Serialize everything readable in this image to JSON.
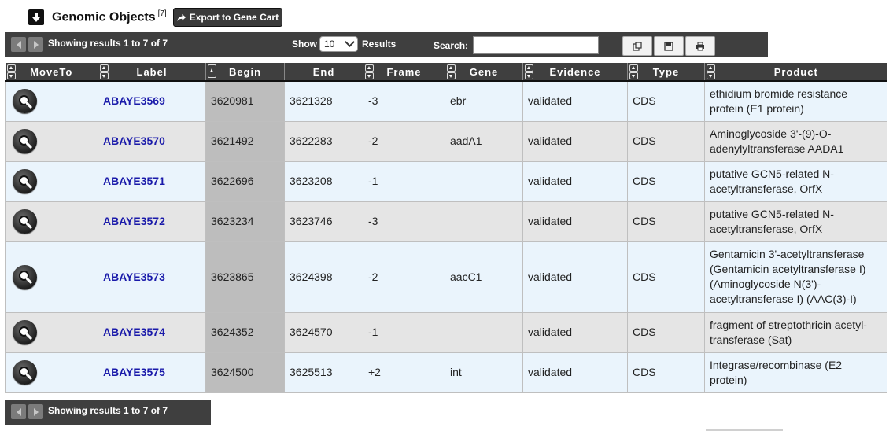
{
  "header": {
    "title": "Genomic Objects",
    "count_sup": "[7]",
    "export_label": "Export to Gene Cart"
  },
  "toolbar": {
    "info": "Showing results 1 to 7 of 7",
    "show_label": "Show",
    "show_value": "10",
    "results_label": "Results",
    "search_label": "Search:",
    "search_value": "",
    "icons": [
      "copy-icon",
      "save-icon",
      "print-icon"
    ]
  },
  "table": {
    "columns": [
      "MoveTo",
      "Label",
      "Begin",
      "End",
      "Frame",
      "Gene",
      "Evidence",
      "Type",
      "Product"
    ],
    "rows": [
      {
        "label": "ABAYE3569",
        "begin": "3620981",
        "end": "3621328",
        "frame": "-3",
        "gene": "ebr",
        "evidence": "validated",
        "type": "CDS",
        "product": "ethidium bromide resistance protein (E1 protein)"
      },
      {
        "label": "ABAYE3570",
        "begin": "3621492",
        "end": "3622283",
        "frame": "-2",
        "gene": "aadA1",
        "evidence": "validated",
        "type": "CDS",
        "product": "Aminoglycoside 3'-(9)-O-adenylyltransferase AADA1"
      },
      {
        "label": "ABAYE3571",
        "begin": "3622696",
        "end": "3623208",
        "frame": "-1",
        "gene": "",
        "evidence": "validated",
        "type": "CDS",
        "product": "putative GCN5-related N-acetyltransferase, OrfX"
      },
      {
        "label": "ABAYE3572",
        "begin": "3623234",
        "end": "3623746",
        "frame": "-3",
        "gene": "",
        "evidence": "validated",
        "type": "CDS",
        "product": "putative GCN5-related N-acetyltransferase, OrfX"
      },
      {
        "label": "ABAYE3573",
        "begin": "3623865",
        "end": "3624398",
        "frame": "-2",
        "gene": "aacC1",
        "evidence": "validated",
        "type": "CDS",
        "product": "Gentamicin 3'-acetyltransferase (Gentamicin acetyltransferase I) (Aminoglycoside N(3')-acetyltransferase I) (AAC(3)-I)"
      },
      {
        "label": "ABAYE3574",
        "begin": "3624352",
        "end": "3624570",
        "frame": "-1",
        "gene": "",
        "evidence": "validated",
        "type": "CDS",
        "product": "fragment of streptothricin acetyl-transferase (Sat)"
      },
      {
        "label": "ABAYE3575",
        "begin": "3624500",
        "end": "3625513",
        "frame": "+2",
        "gene": "int",
        "evidence": "validated",
        "type": "CDS",
        "product": "Integrase/recombinase (E2 protein)"
      }
    ]
  },
  "footer": {
    "info": "Showing results 1 to 7 of 7"
  }
}
